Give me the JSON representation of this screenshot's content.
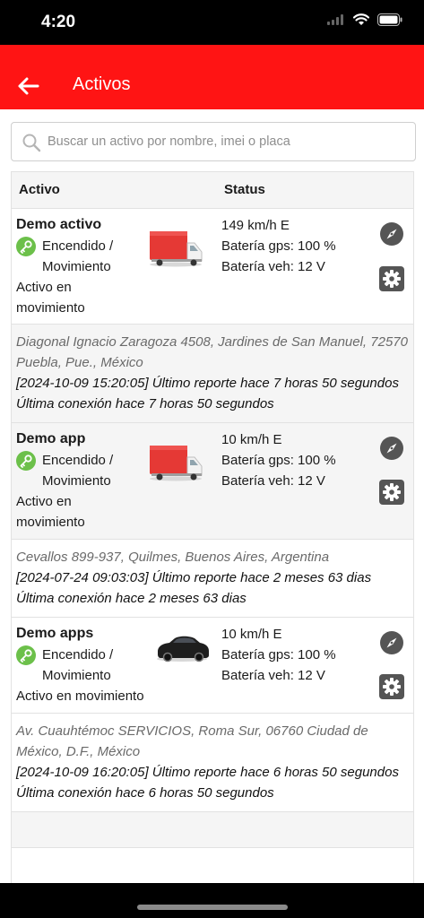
{
  "status_bar": {
    "time": "4:20"
  },
  "header": {
    "title": "Activos"
  },
  "search": {
    "placeholder": "Buscar un activo por nombre, imei o placa"
  },
  "table": {
    "col_activo": "Activo",
    "col_status": "Status"
  },
  "assets": [
    {
      "name": "Demo activo",
      "state": "Encendido / Movimiento",
      "sub": "Activo en movimiento",
      "vehicle_icon": "truck-icon",
      "speed": "149 km/h E",
      "battery_gps": "Batería gps: 100 %",
      "battery_veh": "Batería veh: 12 V",
      "address": "Diagonal Ignacio Zaragoza 4508, Jardines de San Manuel, 72570 Puebla, Pue., México",
      "last_report": "[2024-10-09 15:20:05] Último reporte hace 7 horas 50 segundos",
      "last_connection": "Última conexión hace 7 horas 50 segundos"
    },
    {
      "name": "Demo app",
      "state": "Encendido / Movimiento",
      "sub": "Activo en movimiento",
      "vehicle_icon": "truck-icon",
      "speed": "10 km/h E",
      "battery_gps": "Batería gps: 100 %",
      "battery_veh": "Batería veh: 12 V",
      "address": "Cevallos 899-937, Quilmes, Buenos Aires, Argentina",
      "last_report": "[2024-07-24 09:03:03] Último reporte hace 2 meses 63 dias",
      "last_connection": "Última conexión hace 2 meses 63 dias"
    },
    {
      "name": "Demo apps",
      "state": "Encendido / Movimiento",
      "sub": "Activo en movimiento",
      "vehicle_icon": "car-icon",
      "speed": "10 km/h E",
      "battery_gps": "Batería gps: 100 %",
      "battery_veh": "Batería veh: 12 V",
      "address": "Av. Cuauhtémoc SERVICIOS, Roma Sur, 06760 Ciudad de México, D.F., México",
      "last_report": "[2024-10-09 16:20:05] Último reporte hace 6 horas 50 segundos",
      "last_connection": "Última conexión hace 6 horas 50 segundos"
    }
  ],
  "colors": {
    "accent": "#ff1414",
    "key_green": "#6cc04a",
    "icon_gray": "#555555",
    "truck_red": "#e53935"
  }
}
